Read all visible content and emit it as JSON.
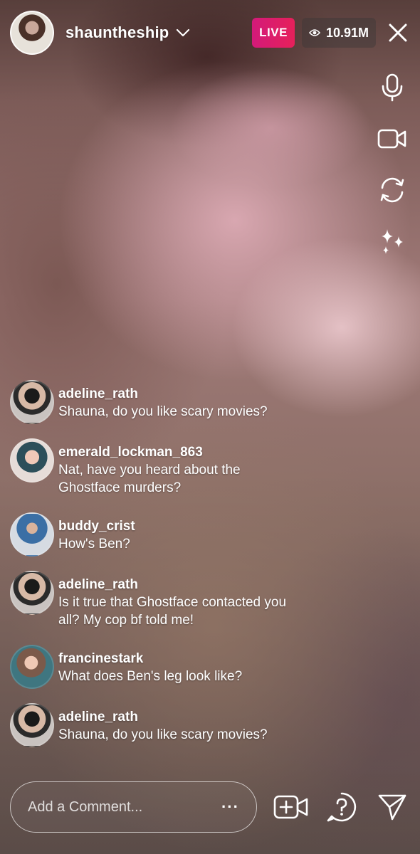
{
  "header": {
    "username": "shauntheship",
    "live_label": "LIVE",
    "viewer_count": "10.91M"
  },
  "right_controls": [
    "microphone-icon",
    "video-camera-icon",
    "switch-camera-icon",
    "effects-sparkle-icon"
  ],
  "comments": [
    {
      "user": "adeline_rath",
      "text": "Shauna, do you like scary movies?",
      "avatar": "adeline"
    },
    {
      "user": "emerald_lockman_863",
      "text": "Nat, have you heard about the Ghostface murders?",
      "avatar": "emerald"
    },
    {
      "user": "buddy_crist",
      "text": "How's Ben?",
      "avatar": "buddy"
    },
    {
      "user": "adeline_rath",
      "text": "Is it true that Ghostface contacted you all? My cop bf told me!",
      "avatar": "adeline"
    },
    {
      "user": "francinestark",
      "text": "What does Ben's leg look like?",
      "avatar": "francine"
    },
    {
      "user": "adeline_rath",
      "text": "Shauna, do you like scary movies?",
      "avatar": "adeline"
    }
  ],
  "composer": {
    "placeholder": "Add a Comment...",
    "more_label": "···"
  },
  "colors": {
    "live_badge": "#e0206a",
    "text": "#ffffff"
  }
}
